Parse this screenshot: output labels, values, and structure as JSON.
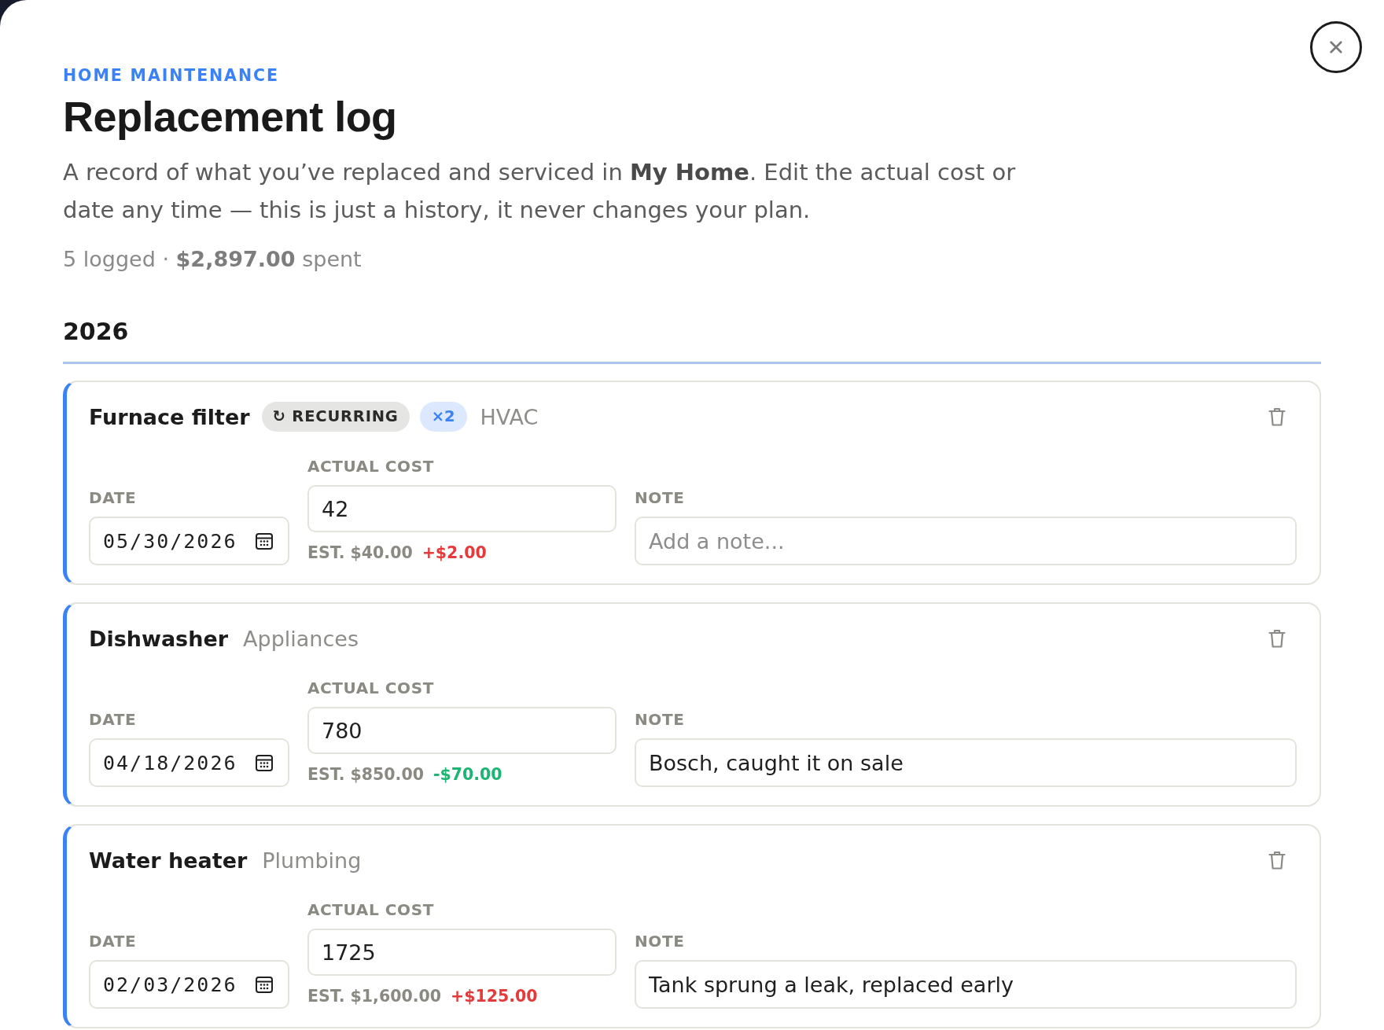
{
  "dialog": {
    "eyebrow": "HOME MAINTENANCE",
    "title": "Replacement log",
    "description": "A record of what you’ve replaced and serviced in **My Home**. Edit the actual cost or date any time — this is just a history, it never changes your plan.",
    "summary": "5 logged · **$2,897.00** spent"
  },
  "groups": [
    {
      "year": "2026",
      "entries": [
        {
          "name": "Furnace filter",
          "tags": [
            {
              "kind": "recurring",
              "label": "↻ RECURRING"
            },
            {
              "kind": "count",
              "label": "×2"
            }
          ],
          "category": "HVAC",
          "date_label": "DATE",
          "date": "05/30/2026",
          "cost_label": "ACTUAL COST",
          "cost": "42",
          "estimate": "EST. $40.00",
          "variance": "+$2.00",
          "over_estimate": true,
          "note_label": "NOTE",
          "note_placeholder": "Add a note..."
        },
        {
          "name": "Dishwasher",
          "category": "Appliances",
          "date_label": "DATE",
          "date": "04/18/2026",
          "cost_label": "ACTUAL COST",
          "cost": "780",
          "estimate": "EST. $850.00",
          "variance": "-$70.00",
          "over_estimate": false,
          "note_label": "NOTE",
          "note": "Bosch, caught it on sale"
        },
        {
          "name": "Water heater",
          "category": "Plumbing",
          "date_label": "DATE",
          "date": "02/03/2026",
          "cost_label": "ACTUAL COST",
          "cost": "1725",
          "estimate": "EST. $1,600.00",
          "variance": "+$125.00",
          "over_estimate": true,
          "note_label": "NOTE",
          "note": "Tank sprung a leak, replaced early"
        }
      ]
    }
  ]
}
